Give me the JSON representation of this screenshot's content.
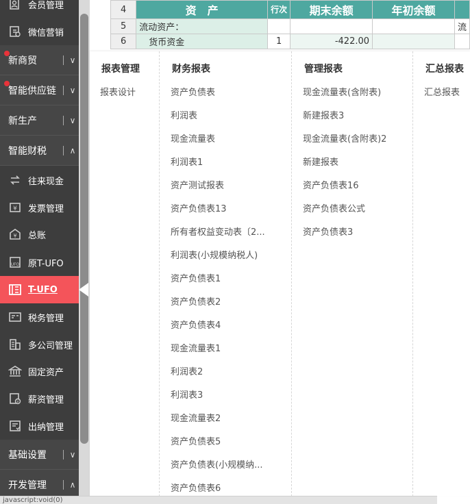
{
  "sidebar": {
    "top_items": [
      {
        "label": "会员管理",
        "icon": "member-icon"
      },
      {
        "label": "微信营销",
        "icon": "wechat-marketing-icon"
      }
    ],
    "groups": [
      {
        "label": "新商贸",
        "dot": true,
        "chevron": "down"
      },
      {
        "label": "智能供应链",
        "dot": true,
        "chevron": "down"
      },
      {
        "label": "新生产",
        "dot": false,
        "chevron": "down"
      },
      {
        "label": "智能财税",
        "dot": false,
        "chevron": "up"
      }
    ],
    "finance_items": [
      {
        "label": "往来现金",
        "icon": "transfer-icon"
      },
      {
        "label": "发票管理",
        "icon": "invoice-icon"
      },
      {
        "label": "总账",
        "icon": "ledger-icon"
      },
      {
        "label": "原T-UFO",
        "icon": "ufo-icon"
      },
      {
        "label": "T-UFO",
        "icon": "t-ufo-icon",
        "active": true
      },
      {
        "label": "税务管理",
        "icon": "tax-icon"
      },
      {
        "label": "多公司管理",
        "icon": "multi-company-icon"
      },
      {
        "label": "固定资产",
        "icon": "fixed-asset-icon"
      },
      {
        "label": "薪资管理",
        "icon": "salary-icon"
      },
      {
        "label": "出纳管理",
        "icon": "cashier-icon"
      }
    ],
    "bottom_groups": [
      {
        "label": "基础设置",
        "chevron": "down"
      },
      {
        "label": "开发管理",
        "chevron": "up"
      }
    ],
    "active_color": "#f4545a"
  },
  "sheet": {
    "header": {
      "row": "4",
      "col_asset": "资　产",
      "col_line": "行次",
      "col_end": "期末余额",
      "col_begin": "年初余额"
    },
    "rows": [
      {
        "row": "5",
        "name": "流动资产：",
        "line": "",
        "end": "",
        "begin": "",
        "extra": "流"
      },
      {
        "row": "6",
        "name": "货币资金",
        "line": "1",
        "end": "-422.00",
        "begin": "",
        "extra": ""
      }
    ],
    "header_color": "#4ea8a0"
  },
  "menu": {
    "col1": {
      "title": "报表管理",
      "items": [
        "报表设计"
      ]
    },
    "col2": {
      "title": "财务报表",
      "items": [
        "资产负债表",
        "利润表",
        "现金流量表",
        "利润表1",
        "资产测试报表",
        "资产负债表13",
        "所有者权益变动表〔2...",
        "利润表(小规模纳税人)",
        "资产负债表1",
        "资产负债表2",
        "资产负债表4",
        "现金流量表1",
        "利润表2",
        "利润表3",
        "现金流量表2",
        "资产负债表5",
        "资产负债表(小规模纳...",
        "资产负债表6"
      ]
    },
    "col3": {
      "title": "管理报表",
      "items": [
        "现金流量表(含附表)",
        "新建报表3",
        "现金流量表(含附表)2",
        "新建报表",
        "资产负债表16",
        "资产负债表公式",
        "资产负债表3"
      ]
    },
    "col4": {
      "title": "汇总报表",
      "items": [
        "汇总报表"
      ]
    }
  },
  "status": {
    "text": "javascript:void(0)"
  }
}
